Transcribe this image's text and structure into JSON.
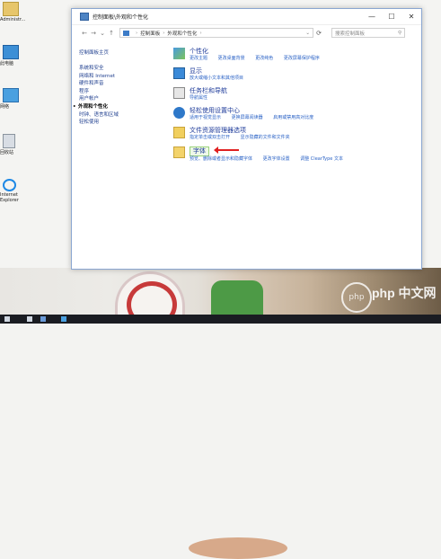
{
  "desktop": {
    "icons": [
      {
        "label": "Administr...",
        "icon": "user-folder-icon"
      },
      {
        "label": "此电脑",
        "icon": "computer-icon"
      },
      {
        "label": "网络",
        "icon": "network-icon"
      },
      {
        "label": "回收站",
        "icon": "recycle-bin-icon"
      },
      {
        "label": "Internet Explorer",
        "icon": "ie-icon"
      }
    ],
    "watermark": "php 中文网",
    "watermark_badge": "php"
  },
  "window": {
    "title": "控制面板\\外观和个性化",
    "buttons": {
      "minimize": "—",
      "maximize": "☐",
      "close": "✕"
    },
    "address": {
      "crumbs": [
        "控制面板",
        "外观和个性化"
      ],
      "search_placeholder": "搜索控制面板"
    },
    "nav": {
      "back": "←",
      "forward": "→",
      "history": "⌄",
      "up": "↑",
      "refresh": "⟳"
    },
    "sidebar": {
      "home": "控制面板主页",
      "items": [
        "系统和安全",
        "网络和 Internet",
        "硬件和声音",
        "程序",
        "用户帐户",
        "外观和个性化",
        "时钟、语言和区域",
        "轻松使用"
      ],
      "current_index": 5
    },
    "categories": [
      {
        "title": "个性化",
        "icon": "personalization-icon",
        "links": [
          "更改主题",
          "更改桌面背景",
          "更改纯色",
          "更改屏幕保护程序"
        ]
      },
      {
        "title": "显示",
        "icon": "display-icon",
        "links": [
          "放大或缩小文本和其他项目"
        ]
      },
      {
        "title": "任务栏和导航",
        "icon": "taskbar-icon",
        "links": [
          "导航属性"
        ]
      },
      {
        "title": "轻松使用设置中心",
        "icon": "ease-of-access-icon",
        "links": [
          "适用于视觉显示",
          "更换屏幕阅读器",
          "启用或禁用高对比度"
        ]
      },
      {
        "title": "文件资源管理器选项",
        "icon": "folder-options-icon",
        "links": [
          "指定单击或双击打开",
          "显示隐藏的文件和文件夹"
        ]
      },
      {
        "title": "字体",
        "icon": "fonts-icon",
        "links": [
          "预览、删除或者显示和隐藏字体",
          "更改字体设置",
          "调整 ClearType 文本"
        ]
      }
    ]
  }
}
